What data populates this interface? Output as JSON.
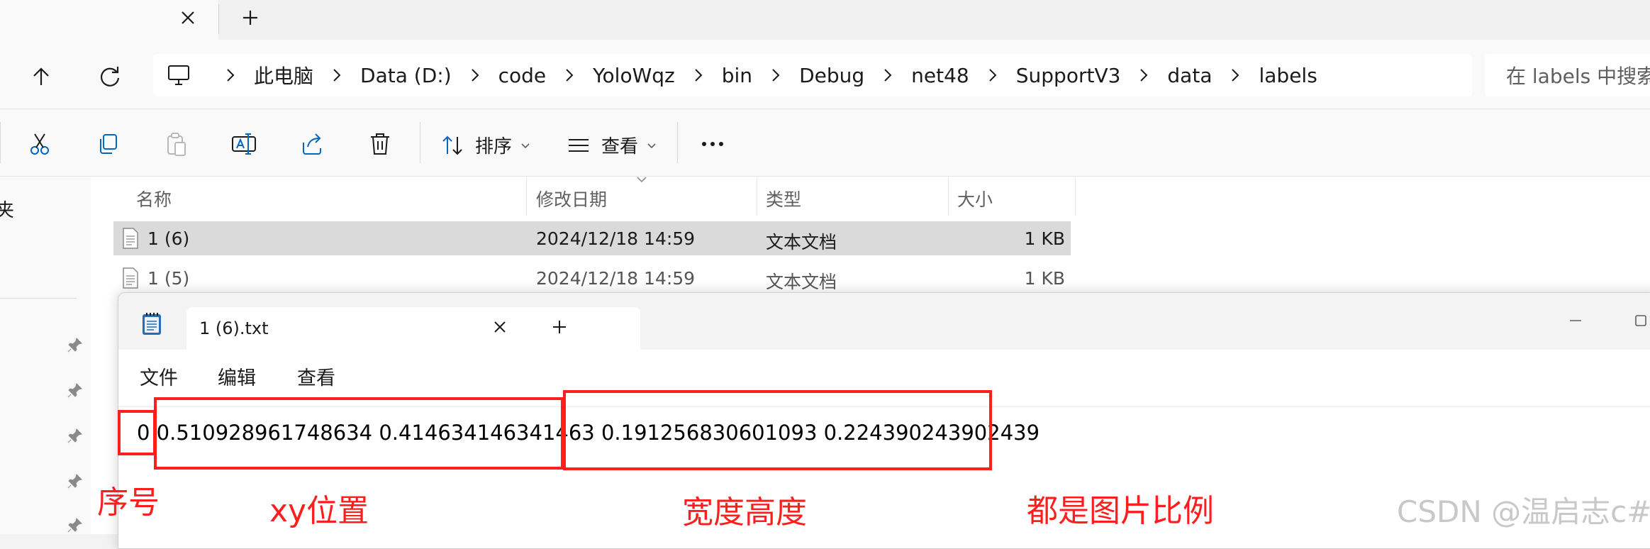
{
  "explorer": {
    "breadcrumb": [
      "此电脑",
      "Data (D:)",
      "code",
      "YoloWqz",
      "bin",
      "Debug",
      "net48",
      "SupportV3",
      "data",
      "labels"
    ],
    "search_placeholder": "在 labels 中搜索",
    "toolbar": {
      "sort_label": "排序",
      "view_label": "查看"
    },
    "nav_partial_text": "夹",
    "columns": {
      "name": "名称",
      "modified": "修改日期",
      "type": "类型",
      "size": "大小"
    },
    "files": [
      {
        "name": "1 (6)",
        "modified": "2024/12/18 14:59",
        "type": "文本文档",
        "size": "1 KB"
      },
      {
        "name": "1 (5)",
        "modified": "2024/12/18 14:59",
        "type": "文本文档",
        "size": "1 KB"
      }
    ]
  },
  "notepad": {
    "tab_title": "1 (6).txt",
    "menu": [
      "文件",
      "编辑",
      "查看"
    ],
    "content": "0 0.510928961748634 0.414634146341463 0.191256830601093 0.224390243902439"
  },
  "annotations": {
    "index_label": "序号",
    "xy_label": "xy位置",
    "wh_label": "宽度高度",
    "ratio_label": "都是图片比例",
    "color": "#ff1e1e"
  },
  "watermark": "CSDN @温启志c#",
  "colors": {
    "accent": "#0067c0",
    "selected_row": "#dadada"
  }
}
